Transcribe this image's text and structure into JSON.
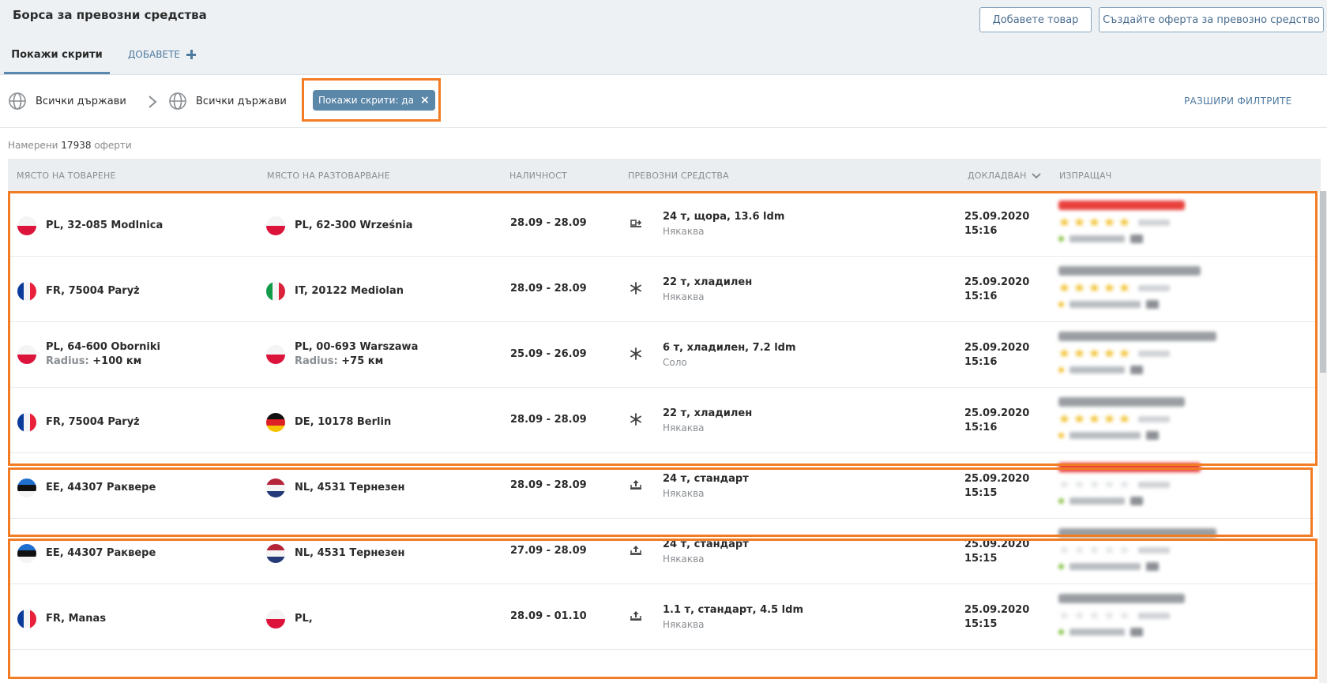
{
  "header": {
    "title": "Борса за превозни средства",
    "add_goods_label": "Добавете товар",
    "create_offer_label": "Създайте оферта за превозно средство",
    "tabs": [
      {
        "label": "Покажи скрити"
      }
    ],
    "add_tab_label": "ДОБАВЕТЕ"
  },
  "filters": {
    "from_country": "Всички държави",
    "to_country": "Всички държави",
    "chip_label": "Покажи скрити: да",
    "chip_close": "×",
    "expand_label": "РАЗШИРИ ФИЛТРИТЕ"
  },
  "results": {
    "prefix": "Намерени",
    "count": "17938",
    "suffix": "оферти"
  },
  "columns": {
    "load": "МЯСТО НА ТОВАРЕНЕ",
    "unload": "МЯСТО НА РАЗТОВАРВАНЕ",
    "availability": "НАЛИЧНОСТ",
    "vehicles": "ПРЕВОЗНИ СРЕДСТВА",
    "reported": "ДОКЛАДВАН",
    "sender": "ИЗПРАЩАЧ"
  },
  "colors": {
    "accent": "#5b87a8",
    "highlight": "#f27c24",
    "link": "#4f7aa0"
  },
  "rows": [
    {
      "load": "PL, 32-085 Modlnica",
      "load_flag": "pl",
      "load_radius_label": "",
      "load_radius": "",
      "unload": "PL, 62-300 Września",
      "unload_flag": "pl",
      "unload_radius_label": "",
      "unload_radius": "",
      "avail": "28.09 - 28.09",
      "vehicle_icon": "curtain-truck-icon",
      "vehicle": "24 т, щора, 13.6 ldm",
      "vehicle_sub": "Някаква",
      "date": "25.09.2020",
      "time": "15:16",
      "sender_rating": 5,
      "sender_name_color": "#e8413d",
      "sender_dot": "#8bc34a"
    },
    {
      "load": "FR, 75004 Paryż",
      "load_flag": "fr",
      "load_radius_label": "",
      "load_radius": "",
      "unload": "IT, 20122 Mediolan",
      "unload_flag": "it",
      "unload_radius_label": "",
      "unload_radius": "",
      "avail": "28.09 - 28.09",
      "vehicle_icon": "snowflake-icon",
      "vehicle": "22 т, хладилен",
      "vehicle_sub": "Някаква",
      "date": "25.09.2020",
      "time": "15:16",
      "sender_rating": 5,
      "sender_name_color": "#9a9ea2",
      "sender_dot": "#f2c233"
    },
    {
      "load": "PL, 64-600 Oborniki",
      "load_flag": "pl",
      "load_radius_label": "Radius:",
      "load_radius": "+100 км",
      "unload": "PL, 00-693 Warszawa",
      "unload_flag": "pl",
      "unload_radius_label": "Radius:",
      "unload_radius": "+75 км",
      "avail": "25.09 - 26.09",
      "vehicle_icon": "snowflake-icon",
      "vehicle": "6 т, хладилен, 7.2 ldm",
      "vehicle_sub": "Соло",
      "date": "25.09.2020",
      "time": "15:16",
      "sender_rating": 5,
      "sender_name_color": "#9a9ea2",
      "sender_dot": "#f2c233"
    },
    {
      "load": "FR, 75004 Paryż",
      "load_flag": "fr",
      "load_radius_label": "",
      "load_radius": "",
      "unload": "DE, 10178 Berlin",
      "unload_flag": "de",
      "unload_radius_label": "",
      "unload_radius": "",
      "avail": "28.09 - 28.09",
      "vehicle_icon": "snowflake-icon",
      "vehicle": "22 т, хладилен",
      "vehicle_sub": "Някаква",
      "date": "25.09.2020",
      "time": "15:16",
      "sender_rating": 5,
      "sender_name_color": "#9a9ea2",
      "sender_dot": "#f2c233"
    },
    {
      "load": "EE, 44307 Раквере",
      "load_flag": "ee",
      "load_radius_label": "",
      "load_radius": "",
      "unload": "NL, 4531 Тернезен",
      "unload_flag": "nl",
      "unload_radius_label": "",
      "unload_radius": "",
      "avail": "28.09 - 28.09",
      "vehicle_icon": "tipper-truck-icon",
      "vehicle": "24 т, стандарт",
      "vehicle_sub": "Някаква",
      "date": "25.09.2020",
      "time": "15:15",
      "sender_rating": 0,
      "sender_name_color": "#e8413d",
      "sender_dot": "#8bc34a"
    },
    {
      "load": "EE, 44307 Раквере",
      "load_flag": "ee",
      "load_radius_label": "",
      "load_radius": "",
      "unload": "NL, 4531 Тернезен",
      "unload_flag": "nl",
      "unload_radius_label": "",
      "unload_radius": "",
      "avail": "27.09 - 28.09",
      "vehicle_icon": "tipper-truck-icon",
      "vehicle": "24 т, стандарт",
      "vehicle_sub": "Някаква",
      "date": "25.09.2020",
      "time": "15:15",
      "sender_rating": 0,
      "sender_name_color": "#9a9ea2",
      "sender_dot": "#8bc34a"
    },
    {
      "load": "FR, Manas",
      "load_flag": "fr",
      "load_radius_label": "",
      "load_radius": "",
      "unload": "PL,",
      "unload_flag": "pl",
      "unload_radius_label": "",
      "unload_radius": "",
      "avail": "28.09 - 01.10",
      "vehicle_icon": "tipper-truck-icon",
      "vehicle": "1.1 т, стандарт, 4.5 ldm",
      "vehicle_sub": "Някаква",
      "date": "25.09.2020",
      "time": "15:15",
      "sender_rating": 0,
      "sender_name_color": "#9a9ea2",
      "sender_dot": "#8bc34a"
    }
  ]
}
